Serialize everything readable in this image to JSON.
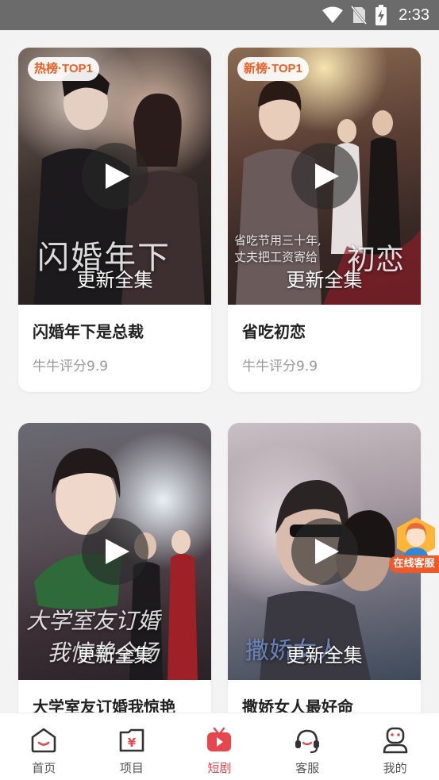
{
  "status_bar": {
    "time": "2:33"
  },
  "cards": [
    {
      "badge": "热榜·TOP1",
      "update": "更新全集",
      "title": "闪婚年下是总裁",
      "score": "牛牛评分9.9"
    },
    {
      "badge": "新榜·TOP1",
      "update": "更新全集",
      "title": "省吃初恋",
      "score": "牛牛评分9.9"
    },
    {
      "update": "更新全集",
      "title": "大学室友订婚我惊艳"
    },
    {
      "update": "更新全集",
      "title": "撒娇女人最好命"
    }
  ],
  "floating_service": {
    "label": "在线客服"
  },
  "tabs": [
    {
      "label": "首页"
    },
    {
      "label": "项目"
    },
    {
      "label": "短剧"
    },
    {
      "label": "客服"
    },
    {
      "label": "我的"
    }
  ],
  "colors": {
    "accent": "#e8464c",
    "badge_text": "#f25d22",
    "service": "#f05a28"
  }
}
